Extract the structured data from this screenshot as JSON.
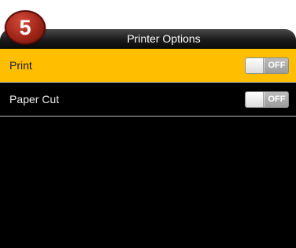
{
  "step_badge": {
    "number": "5"
  },
  "header": {
    "title": "Printer Options"
  },
  "options": [
    {
      "label": "Print",
      "state": "OFF",
      "selected": true
    },
    {
      "label": "Paper Cut",
      "state": "OFF",
      "selected": false
    }
  ],
  "colors": {
    "highlight": "#ffbe00",
    "background": "#000000",
    "badge": "#a12618"
  }
}
